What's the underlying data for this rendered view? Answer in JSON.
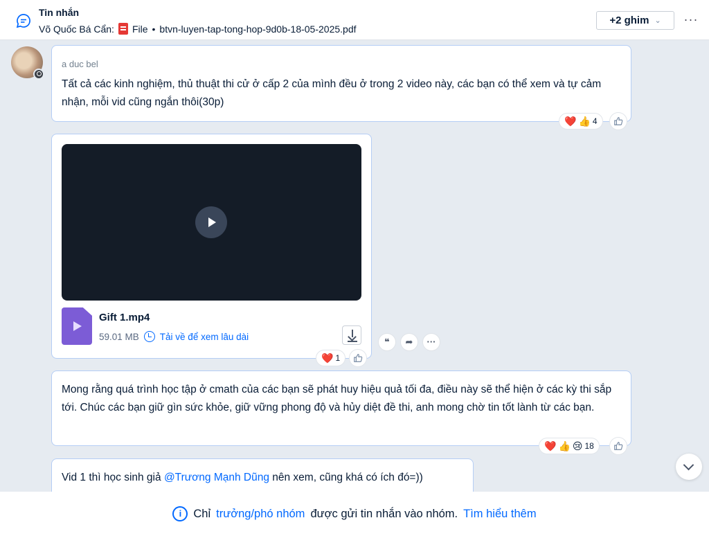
{
  "pinned": {
    "title": "Tin nhắn",
    "sender": "Võ Quốc Bá Cẩn:",
    "file_label": "File",
    "separator": "•",
    "file_name": "btvn-luyen-tap-tong-hop-9d0b-18-05-2025.pdf",
    "pins_button": "+2 ghim",
    "more": "···"
  },
  "messages": [
    {
      "sender": "a duc bel",
      "text": "Tất cả các kinh nghiệm, thủ thuật thi cử ở cấp 2 của mình đều ở trong 2 video này, các bạn có thể xem và tự cảm nhận, mỗi vid cũng ngắn thôi(30p)",
      "reactions": {
        "emojis": [
          "❤️",
          "👍"
        ],
        "count": "4"
      }
    },
    {
      "video": {
        "file_name": "Gift 1.mp4",
        "size": "59.01 MB",
        "download_text": "Tải về để xem lâu dài"
      },
      "reactions": {
        "emojis": [
          "❤️"
        ],
        "count": "1"
      },
      "actions": [
        "quote",
        "forward",
        "more"
      ]
    },
    {
      "text": "Mong rằng quá trình học tập ở cmath của các bạn sẽ phát huy hiệu quả tối đa, điều này sẽ thể hiện ở các kỳ thi sắp tới. Chúc các bạn giữ gìn sức khỏe, giữ vững phong độ và hủy diệt đề thi, anh mong chờ tin tốt lành từ các bạn.",
      "reactions": {
        "emojis": [
          "❤️",
          "👍",
          "😢"
        ],
        "count": "18"
      }
    },
    {
      "text_before": "Vid 1 thì học sinh giả ",
      "mention": "@Trương Mạnh Dũng",
      "text_after": " nên xem, cũng khá có ích đó=))"
    }
  ],
  "footer": {
    "prefix": "Chỉ",
    "role_link": "trưởng/phó nhóm",
    "middle": "được gửi tin nhắn vào nhóm.",
    "learn_more": "Tìm hiểu thêm"
  },
  "colors": {
    "accent": "#0068ff",
    "bubble_border": "#b4cdf5",
    "background": "#e6ebf1"
  }
}
